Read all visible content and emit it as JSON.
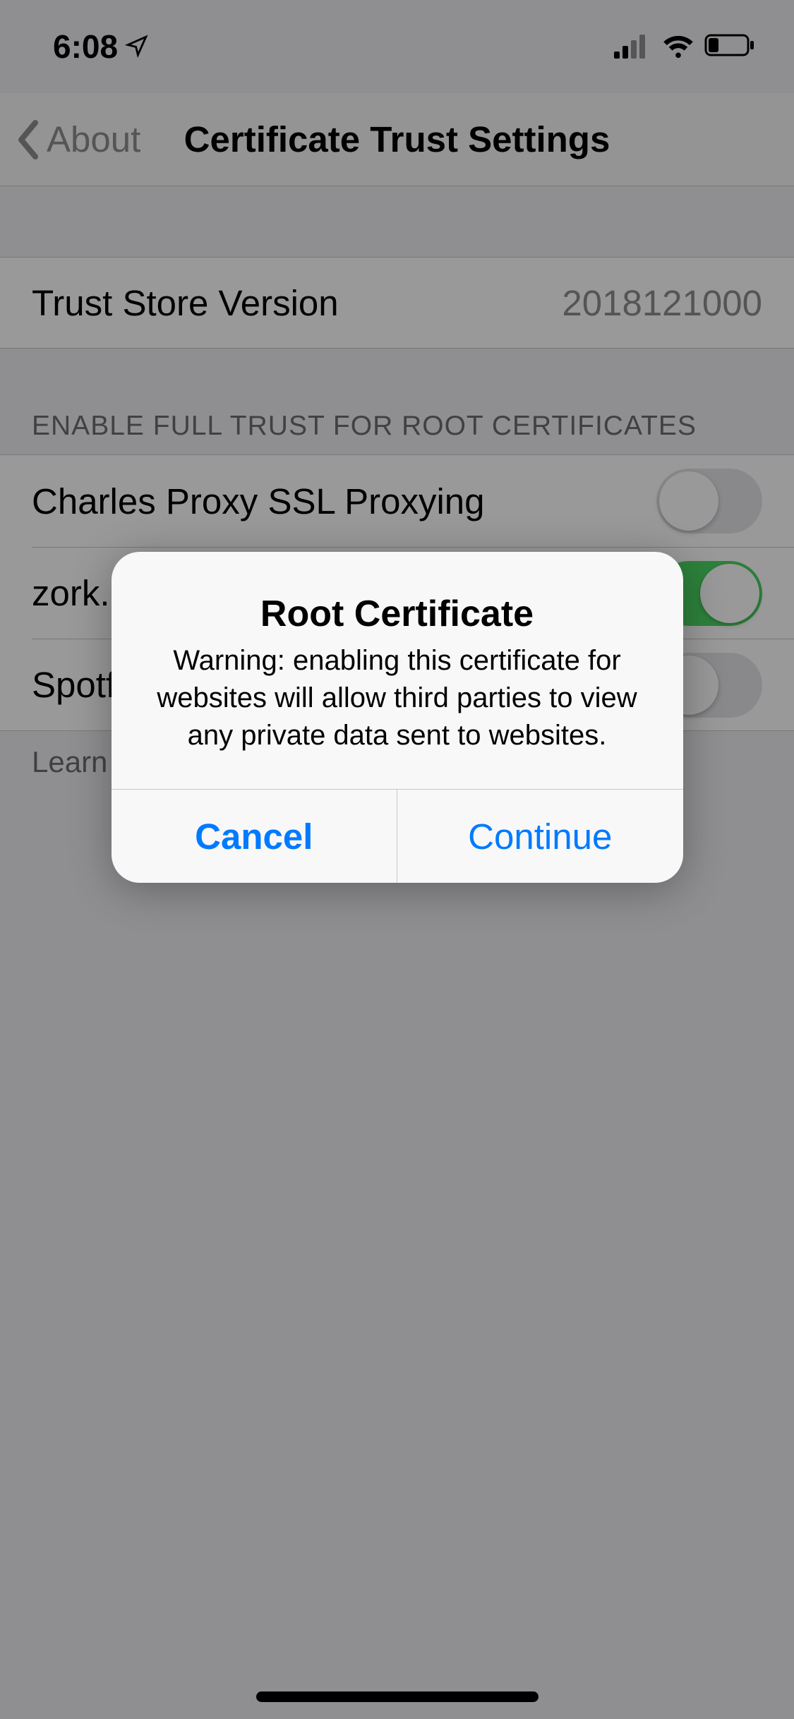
{
  "statusBar": {
    "time": "6:08",
    "cellularBars": 2,
    "wifi": true,
    "batteryLevel": 0.25
  },
  "nav": {
    "backLabel": "About",
    "title": "Certificate Trust Settings"
  },
  "trustStore": {
    "label": "Trust Store Version",
    "value": "2018121000"
  },
  "certSection": {
    "header": "ENABLE FULL TRUST FOR ROOT CERTIFICATES",
    "items": [
      {
        "label": "Charles Proxy SSL Proxying",
        "enabled": false
      },
      {
        "label": "zork.bubv.net",
        "enabled": true
      },
      {
        "label": "Spotflux Certificate Authority",
        "enabled": false
      }
    ],
    "footerPrefix": "Learn"
  },
  "alert": {
    "title": "Root Certificate",
    "message": "Warning: enabling this certificate for websites will allow third parties to view any private data sent to websites.",
    "cancel": "Cancel",
    "continue": "Continue"
  }
}
